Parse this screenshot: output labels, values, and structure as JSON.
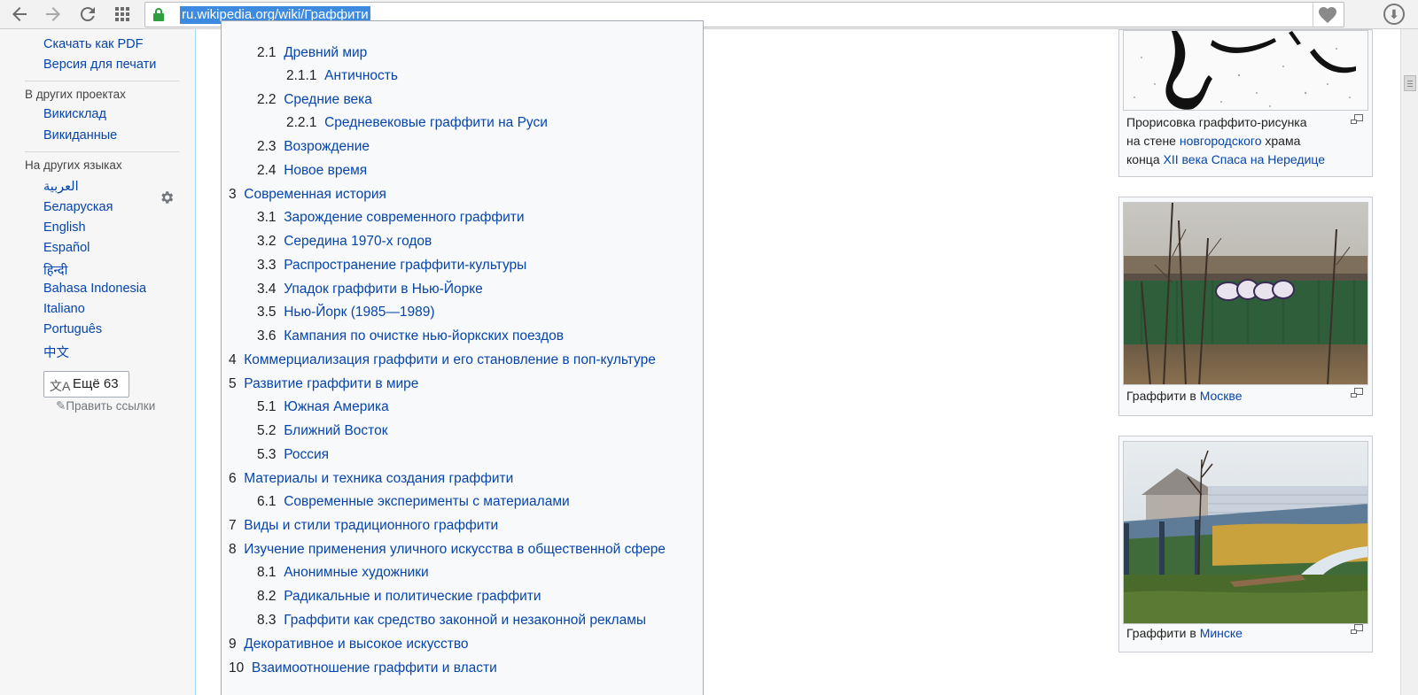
{
  "browser": {
    "url": "ru.wikipedia.org/wiki/Граффити",
    "icons": [
      "back-icon",
      "forward-icon",
      "reload-icon",
      "apps-icon",
      "lock-icon",
      "heart-icon",
      "download-icon"
    ]
  },
  "sidebar": {
    "tools": [
      "Скачать как PDF",
      "Версия для печати"
    ],
    "projects_heading": "В других проектах",
    "projects": [
      "Викисклад",
      "Викиданные"
    ],
    "languages_heading": "На других языках",
    "languages": [
      "العربية",
      "Беларуская",
      "English",
      "Español",
      "हिन्दी",
      "Bahasa Indonesia",
      "Italiano",
      "Português",
      "中文"
    ],
    "more_languages": "Ещё 63",
    "edit_links": "Править ссылки"
  },
  "toc": [
    {
      "num": "2.1",
      "text": "Древний мир"
    },
    {
      "num": "2.1.1",
      "text": "Античность"
    },
    {
      "num": "2.2",
      "text": "Средние века"
    },
    {
      "num": "2.2.1",
      "text": "Средневековые граффити на Руси"
    },
    {
      "num": "2.3",
      "text": "Возрождение"
    },
    {
      "num": "2.4",
      "text": "Новое время"
    },
    {
      "num": "3",
      "text": "Современная история"
    },
    {
      "num": "3.1",
      "text": "Зарождение современного граффити"
    },
    {
      "num": "3.2",
      "text": "Середина 1970-х годов"
    },
    {
      "num": "3.3",
      "text": "Распространение граффити-культуры"
    },
    {
      "num": "3.4",
      "text": "Упадок граффити в Нью-Йорке"
    },
    {
      "num": "3.5",
      "text": "Нью-Йорк (1985—1989)"
    },
    {
      "num": "3.6",
      "text": "Кампания по очистке нью-йоркских поездов"
    },
    {
      "num": "4",
      "text": "Коммерциализация граффити и его становление в поп-культуре"
    },
    {
      "num": "5",
      "text": "Развитие граффити в мире"
    },
    {
      "num": "5.1",
      "text": "Южная Америка"
    },
    {
      "num": "5.2",
      "text": "Ближний Восток"
    },
    {
      "num": "5.3",
      "text": "Россия"
    },
    {
      "num": "6",
      "text": "Материалы и техника создания граффити"
    },
    {
      "num": "6.1",
      "text": "Современные эксперименты с материалами"
    },
    {
      "num": "7",
      "text": "Виды и стили традиционного граффити"
    },
    {
      "num": "8",
      "text": "Изучение применения уличного искусства в общественной сфере"
    },
    {
      "num": "8.1",
      "text": "Анонимные художники"
    },
    {
      "num": "8.2",
      "text": "Радикальные и политические граффити"
    },
    {
      "num": "8.3",
      "text": "Граффити как средство законной и незаконной рекламы"
    },
    {
      "num": "9",
      "text": "Декоративное и высокое искусство"
    },
    {
      "num": "10",
      "text": "Взаимоотношение граффити и власти"
    }
  ],
  "thumbs": {
    "first": {
      "line1": "Прорисовка граффито-рисунка",
      "line2_plain": "на стене ",
      "line2_link": "новгородского",
      "line2_plain2": " храма",
      "line3_plain": "конца ",
      "line3_link1": "XII века",
      "line3_space": " ",
      "line3_link2": "Спаса на Нередице"
    },
    "moscow": {
      "plain": "Граффити в ",
      "link": "Москве"
    },
    "minsk": {
      "plain": "Граффити в ",
      "link": "Минске"
    }
  },
  "colors": {
    "link": "#0645ad",
    "url_highlight": "#3c8be0",
    "lock": "#2e9e3e"
  }
}
